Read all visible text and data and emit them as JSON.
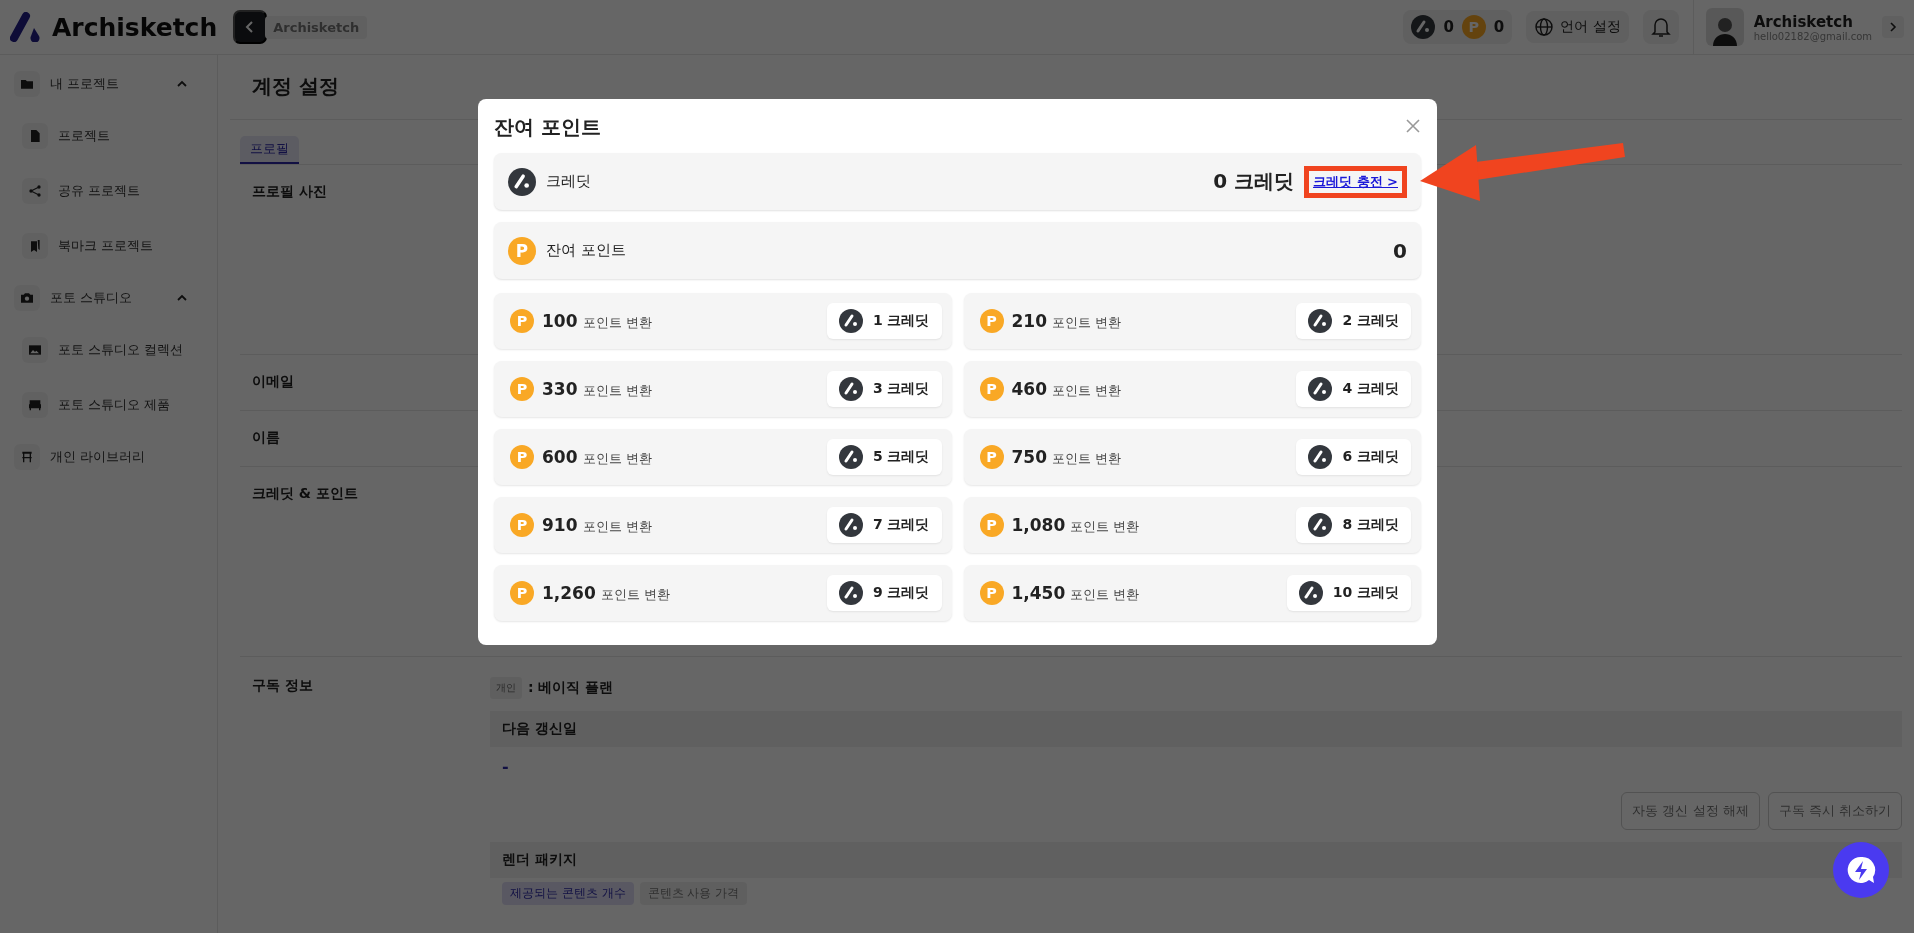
{
  "topbar": {
    "logo": "Archisketch",
    "breadcrumb": "Archisketch",
    "credit_count": "0",
    "point_icon": "P",
    "point_count": "0",
    "language": "언어 설정",
    "user_name": "Archisketch",
    "user_email": "hello02182@gmail.com"
  },
  "sidebar": {
    "groups": [
      {
        "label": "내 프로젝트",
        "expanded": true,
        "children": [
          {
            "label": "프로젝트"
          },
          {
            "label": "공유 프로젝트"
          },
          {
            "label": "북마크 프로젝트"
          }
        ]
      },
      {
        "label": "포토 스튜디오",
        "expanded": true,
        "children": [
          {
            "label": "포토 스튜디오 컬렉션"
          },
          {
            "label": "포토 스튜디오 제품"
          }
        ]
      },
      {
        "label": "개인 라이브러리"
      }
    ]
  },
  "page": {
    "title": "계정 설정",
    "tabs": [
      {
        "label": "프로필",
        "selected": true
      }
    ],
    "sections": [
      {
        "label": "프로필 사진"
      },
      {
        "label": "이메일"
      },
      {
        "label": "이름"
      },
      {
        "label": "크레딧 & 포인트"
      }
    ],
    "subscription": {
      "label": "구독 정보",
      "badge": "개인",
      "plan": ": 베이직 플랜",
      "renewal_header": "다음 갱신일",
      "renewal_value": "-",
      "buttons": [
        "자동 갱신 설정 해제",
        "구독 즉시 취소하기"
      ],
      "package_header": "렌더 패키지",
      "package_tabs": [
        {
          "label": "제공되는 콘텐츠 개수",
          "selected": true
        },
        {
          "label": "콘텐츠 사용 가격",
          "selected": false
        }
      ]
    }
  },
  "modal": {
    "title": "잔여 포인트",
    "credit_row": {
      "label": "크레딧",
      "value": "0 크레딧",
      "link": "크레딧 충전 >"
    },
    "points_row": {
      "icon": "P",
      "label": "잔여 포인트",
      "value": "0"
    },
    "conversions": [
      {
        "icon": "P",
        "points": "100",
        "unit": "포인트 변환",
        "credits": "1 크레딧"
      },
      {
        "icon": "P",
        "points": "210",
        "unit": "포인트 변환",
        "credits": "2 크레딧"
      },
      {
        "icon": "P",
        "points": "330",
        "unit": "포인트 변환",
        "credits": "3 크레딧"
      },
      {
        "icon": "P",
        "points": "460",
        "unit": "포인트 변환",
        "credits": "4 크레딧"
      },
      {
        "icon": "P",
        "points": "600",
        "unit": "포인트 변환",
        "credits": "5 크레딧"
      },
      {
        "icon": "P",
        "points": "750",
        "unit": "포인트 변환",
        "credits": "6 크레딧"
      },
      {
        "icon": "P",
        "points": "910",
        "unit": "포인트 변환",
        "credits": "7 크레딧"
      },
      {
        "icon": "P",
        "points": "1,080",
        "unit": "포인트 변환",
        "credits": "8 크레딧"
      },
      {
        "icon": "P",
        "points": "1,260",
        "unit": "포인트 변환",
        "credits": "9 크레딧"
      },
      {
        "icon": "P",
        "points": "1,450",
        "unit": "포인트 변환",
        "credits": "10 크레딧"
      }
    ]
  }
}
